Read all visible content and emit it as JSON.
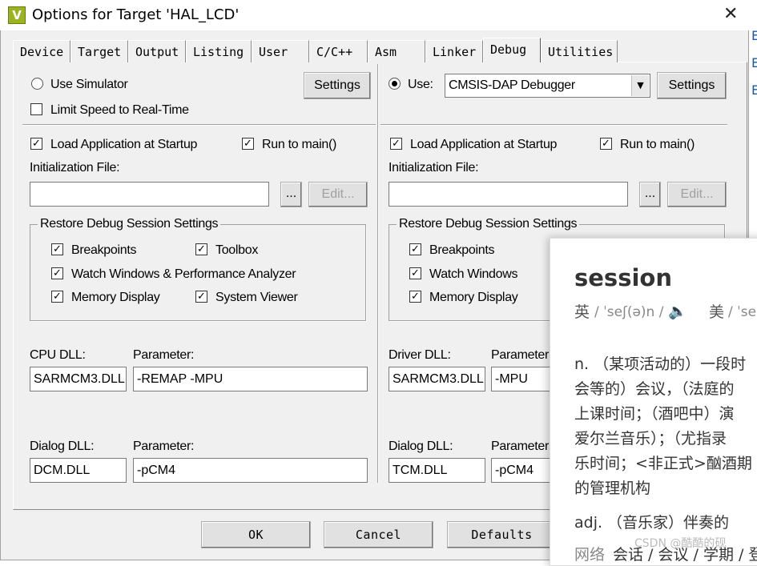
{
  "window": {
    "title": "Options for Target 'HAL_LCD'",
    "icon_letter": "V",
    "close": "✕"
  },
  "tabs": [
    "Device",
    "Target",
    "Output",
    "Listing",
    "User",
    "C/C++",
    "Asm",
    "Linker",
    "Debug",
    "Utilities"
  ],
  "active_tab": "Debug",
  "left": {
    "use_simulator": "Use Simulator",
    "limit_speed": "Limit Speed to Real-Time",
    "settings": "Settings",
    "load_app": "Load Application at Startup",
    "run_to_main": "Run to main()",
    "init_file_label": "Initialization File:",
    "init_file_value": "",
    "browse": "...",
    "edit": "Edit...",
    "restore_group": "Restore Debug Session Settings",
    "breakpoints": "Breakpoints",
    "toolbox": "Toolbox",
    "watch": "Watch Windows & Performance Analyzer",
    "memory": "Memory Display",
    "system_viewer": "System Viewer",
    "cpu_dll_label": "CPU DLL:",
    "cpu_param_label": "Parameter:",
    "cpu_dll": "SARMCM3.DLL",
    "cpu_param": "-REMAP -MPU",
    "dialog_dll_label": "Dialog DLL:",
    "dialog_param_label": "Parameter:",
    "dialog_dll": "DCM.DLL",
    "dialog_param": "-pCM4"
  },
  "right": {
    "use": "Use:",
    "debugger": "CMSIS-DAP Debugger",
    "settings": "Settings",
    "load_app": "Load Application at Startup",
    "run_to_main": "Run to main()",
    "init_file_label": "Initialization File:",
    "init_file_value": "",
    "browse": "...",
    "edit": "Edit...",
    "restore_group": "Restore Debug Session Settings",
    "breakpoints": "Breakpoints",
    "watch": "Watch Windows",
    "memory": "Memory Display",
    "driver_dll_label": "Driver DLL:",
    "driver_param_label": "Parameter",
    "driver_dll": "SARMCM3.DLL",
    "driver_param": "-MPU",
    "dialog_dll_label": "Dialog DLL:",
    "dialog_param_label": "Parameter",
    "dialog_dll": "TCM.DLL",
    "dialog_param": "-pCM4"
  },
  "buttons": {
    "ok": "OK",
    "cancel": "Cancel",
    "defaults": "Defaults"
  },
  "checkbox_mark": "✓",
  "popup": {
    "word": "session",
    "uk_label": "英",
    "uk_phon": "/ ˈseʃ(ə)n /",
    "speaker": "🔈",
    "us_label": "美",
    "us_phon": "/ ˈse",
    "def_lines": [
      "n. （某项活动的）一段时",
      "会等的）会议，（法庭的",
      "上课时间；（酒吧中）演",
      "爱尔兰音乐）；（尤指录",
      "乐时间；<非正式>酗酒期",
      "的管理机构"
    ],
    "adj_line": "adj. （音乐家）伴奏的",
    "net_label": "网络",
    "net_text": "会话 / 会议 / 学期 / 登",
    "watermark": "CSDN @酷酷的砚"
  },
  "edge_letters": [
    "E",
    "E",
    "E"
  ]
}
